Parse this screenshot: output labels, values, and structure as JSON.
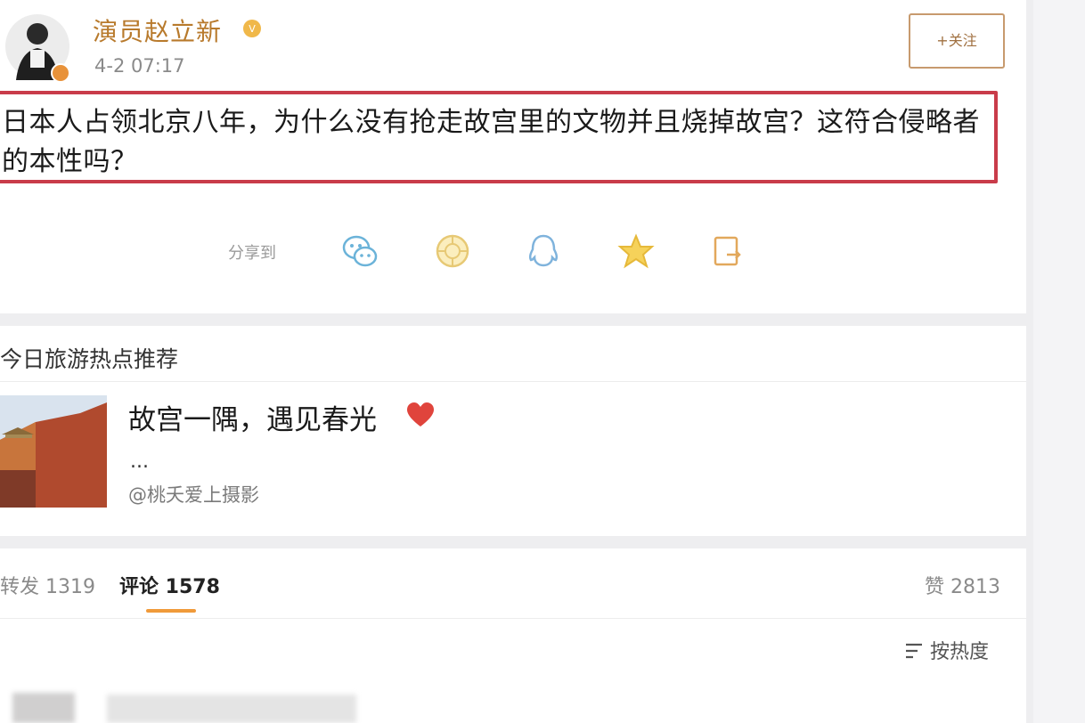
{
  "post": {
    "username": "演员赵立新",
    "time": "4-2 07:17",
    "follow_label": "+关注",
    "content": "日本人占领北京八年，为什么没有抢走故宫里的文物并且烧掉故宫？这符合侵略者的本性吗？",
    "share_label": "分享到",
    "share_icons": [
      "wechat-icon",
      "moments-icon",
      "qq-icon",
      "qzone-icon",
      "copy-link-icon"
    ]
  },
  "recommend": {
    "title": "今日旅游热点推荐",
    "headline": "故宫一隅，遇见春光",
    "ellipsis": "...",
    "author": "@桃夭爱上摄影"
  },
  "comments_bar": {
    "repost_label": "转发 1319",
    "comment_label": "评论 1578",
    "like_label": "赞 2813",
    "sort_label": "按热度"
  },
  "colors": {
    "username": "#b87a2c",
    "highlight_border": "#c93c4a",
    "active_tab_underline": "#f09a3a",
    "heart": "#e0443c"
  }
}
